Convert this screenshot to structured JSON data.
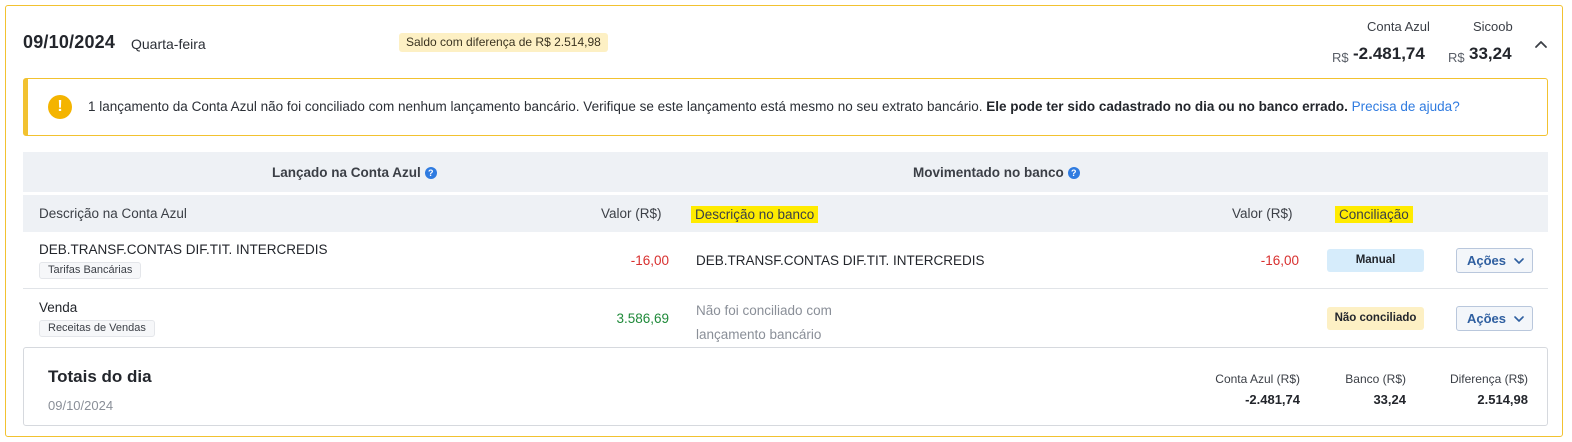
{
  "day": {
    "date": "09/10/2024",
    "weekday": "Quarta-feira",
    "difference_badge": "Saldo com diferença de R$ 2.514,98"
  },
  "balances": {
    "conta_azul_label": "Conta Azul",
    "sicoob_label": "Sicoob",
    "currency": "R$",
    "conta_azul_value": "-2.481,74",
    "sicoob_value": "33,24"
  },
  "alert": {
    "icon": "exclamation-icon",
    "text": "1 lançamento da Conta Azul não foi conciliado com nenhum lançamento bancário. Verifique se este lançamento está mesmo no seu extrato bancário. ",
    "bold_text": "Ele pode ter sido cadastrado no dia ou no banco errado.",
    "link": "Precisa de ajuda?"
  },
  "groups": {
    "left": "Lançado na Conta Azul",
    "right": "Movimentado no banco"
  },
  "columns": {
    "desc_ca": "Descrição na Conta Azul",
    "valor_ca": "Valor (R$)",
    "desc_banco": "Descrição no banco",
    "valor_banco": "Valor (R$)",
    "conciliacao": "Conciliação"
  },
  "rows": [
    {
      "description": "DEB.TRANSF.CONTAS DIF.TIT. INTERCREDIS",
      "category": "Tarifas Bancárias",
      "value": "-16,00",
      "bank_description": "DEB.TRANSF.CONTAS DIF.TIT. INTERCREDIS",
      "bank_value": "-16,00",
      "status": "Manual",
      "action": "Ações"
    },
    {
      "description": "Venda",
      "category": "Receitas de Vendas",
      "value": "3.586,69",
      "bank_description_line1": "Não foi conciliado com",
      "bank_description_line2": "lançamento bancário",
      "status": "Não conciliado",
      "action": "Ações"
    }
  ],
  "totals": {
    "title": "Totais do dia",
    "date": "09/10/2024",
    "ca_label": "Conta Azul (R$)",
    "banco_label": "Banco (R$)",
    "diff_label": "Diferença (R$)",
    "ca_value": "-2.481,74",
    "banco_value": "33,24",
    "diff_value": "2.514,98"
  },
  "colors": {
    "accent_yellow": "#f2c230",
    "negative": "#d8302f",
    "positive": "#1f8a3a",
    "link": "#2f7be0"
  }
}
